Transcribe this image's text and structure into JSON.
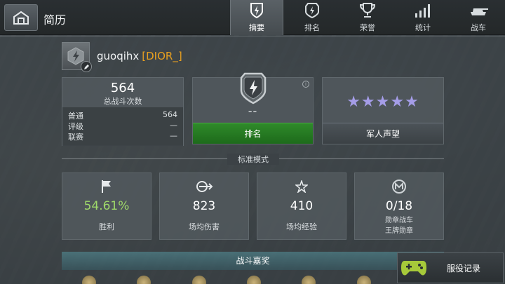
{
  "header": {
    "title": "简历",
    "tabs": [
      {
        "label": "摘要",
        "icon": "shield-emblem-icon",
        "active": true
      },
      {
        "label": "排名",
        "icon": "rank-shield-icon",
        "active": false
      },
      {
        "label": "荣誉",
        "icon": "trophy-icon",
        "active": false
      },
      {
        "label": "统计",
        "icon": "bar-stats-icon",
        "active": false
      },
      {
        "label": "战车",
        "icon": "tank-icon",
        "active": false
      }
    ]
  },
  "profile": {
    "username": "guoqihx",
    "clan_tag": "[DIOR_]"
  },
  "battles": {
    "total": "564",
    "total_label": "总战斗次数",
    "rows": [
      {
        "label": "普通",
        "value": "564"
      },
      {
        "label": "评级",
        "value": "—"
      },
      {
        "label": "联赛",
        "value": "—"
      }
    ]
  },
  "rank": {
    "value": "--",
    "button_label": "排名"
  },
  "reputation": {
    "stars_filled": 5,
    "stars_total": 5,
    "stars_text": "★★★★★",
    "button_label": "军人声望"
  },
  "mode_label": "标准模式",
  "stats": [
    {
      "icon": "flag-icon",
      "value": "54.61%",
      "label": "胜利"
    },
    {
      "icon": "damage-icon",
      "value": "823",
      "label": "场均伤害"
    },
    {
      "icon": "star-icon",
      "value": "410",
      "label": "场均经验"
    },
    {
      "icon": "mastery-badge-icon",
      "value": "0/18",
      "label_line1": "勋章战车",
      "label_line2": "王牌勋章"
    }
  ],
  "awards_label": "战斗嘉奖",
  "record_button": "服役记录",
  "colors": {
    "accent_green": "#2f8a2a",
    "winrate_green": "#9fd96a",
    "clan_orange": "#e8a020",
    "star_purple": "#a59de8"
  }
}
